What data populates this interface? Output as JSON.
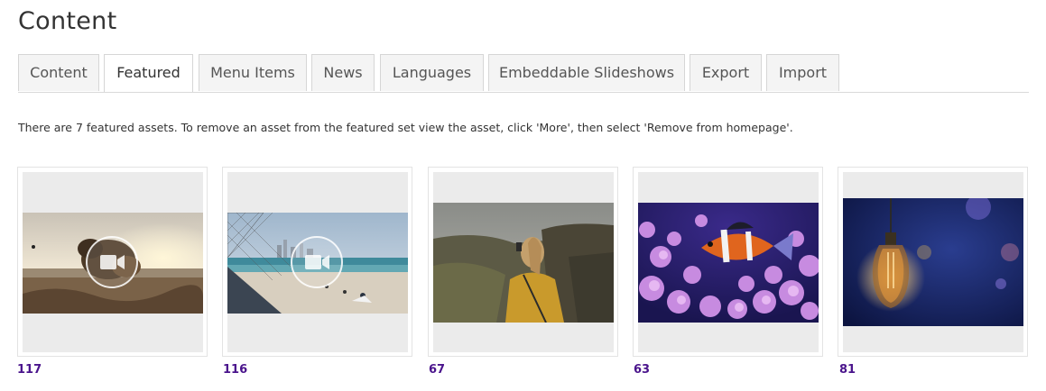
{
  "page": {
    "title": "Content"
  },
  "tabs": [
    {
      "label": "Content",
      "active": false
    },
    {
      "label": "Featured",
      "active": true
    },
    {
      "label": "Menu Items",
      "active": false
    },
    {
      "label": "News",
      "active": false
    },
    {
      "label": "Languages",
      "active": false
    },
    {
      "label": "Embeddable Slideshows",
      "active": false
    },
    {
      "label": "Export",
      "active": false
    },
    {
      "label": "Import",
      "active": false
    }
  ],
  "info_text": "There are 7 featured assets. To remove an asset from the featured set view the asset, click 'More', then select 'Remove from homepage'.",
  "assets": [
    {
      "id": "117",
      "kind": "video",
      "subject": "dog on beach at sunset"
    },
    {
      "id": "116",
      "kind": "video",
      "subject": "beach with city skyline"
    },
    {
      "id": "67",
      "kind": "image",
      "subject": "woman in yellow sweater taking photo"
    },
    {
      "id": "63",
      "kind": "image",
      "subject": "clownfish in anemone"
    },
    {
      "id": "81",
      "kind": "image",
      "subject": "glowing light bulb"
    }
  ],
  "colors": {
    "link": "#4a148c",
    "tab_border": "#d6d6d6",
    "thumb_bg": "#ebebeb"
  },
  "icons": {
    "video": "video-camera-icon"
  }
}
